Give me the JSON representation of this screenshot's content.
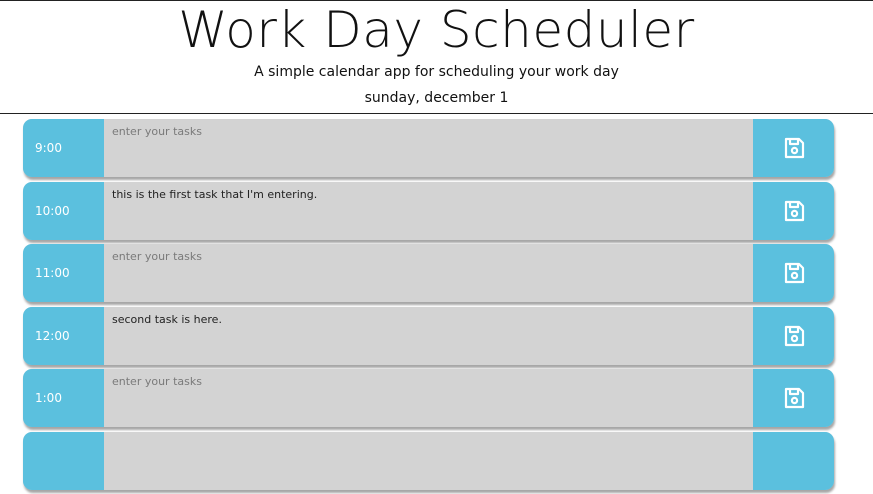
{
  "header": {
    "title": "Work Day Scheduler",
    "subtitle": "A simple calendar app for scheduling your work day",
    "current_date": "sunday, december 1"
  },
  "schedule": {
    "placeholder": "enter your tasks",
    "save_icon": "floppy-disk-icon",
    "colors": {
      "hour_bg": "#5bc0de",
      "task_bg": "#d3d3d3"
    },
    "rows": [
      {
        "hour": "9:00",
        "task": ""
      },
      {
        "hour": "10:00",
        "task": "this is the first task that I'm entering."
      },
      {
        "hour": "11:00",
        "task": ""
      },
      {
        "hour": "12:00",
        "task": "second task is here."
      },
      {
        "hour": "1:00",
        "task": ""
      },
      {
        "hour": "",
        "task": ""
      }
    ]
  }
}
